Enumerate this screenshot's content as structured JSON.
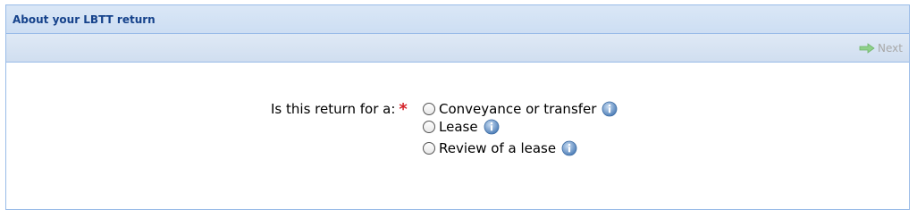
{
  "panel": {
    "title": "About your LBTT return"
  },
  "toolbar": {
    "next_label": "Next",
    "next_icon": "arrow-right-icon"
  },
  "form": {
    "question_label": "Is this return for a:",
    "required_marker": "*",
    "options": [
      {
        "label": "Conveyance or transfer",
        "selected": false,
        "info_icon": "info-icon"
      },
      {
        "label": "Lease",
        "selected": false,
        "info_icon": "info-icon"
      },
      {
        "label": "Review of a lease",
        "selected": false,
        "info_icon": "info-icon"
      }
    ]
  },
  "colors": {
    "title_text": "#15428b",
    "border": "#99bbe8",
    "required": "#d42027",
    "disabled_text": "#a8a8a8",
    "info_icon": "#5a8bc2"
  }
}
